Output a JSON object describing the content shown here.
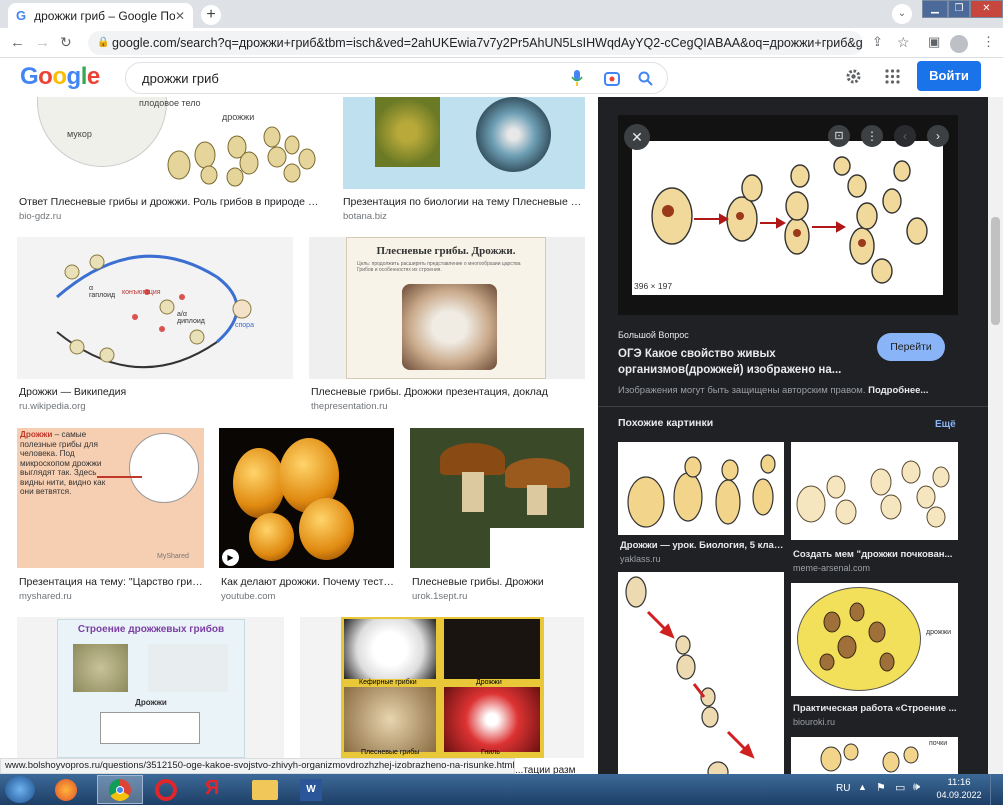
{
  "browser": {
    "tab_title": "дрожжи гриб – Google Поиск",
    "url": "google.com/search?q=дрожжи+гриб&tbm=isch&ved=2ahUKEwia7v7y2Pr5AhUN5LsIHWqdAyYQ2-cCegQIABAA&oq=дрожжи+гриб&gs_lcp=CgNpbW..."
  },
  "google": {
    "logo": "Google",
    "query": "дрожжи гриб",
    "signin_label": "Войти"
  },
  "results": [
    {
      "caption": "Ответ Плесневые грибы и дрожжи. Роль грибов в природе и жиз...",
      "site": "bio-gdz.ru"
    },
    {
      "caption": "Презентация по биологии на тему Плесневые гри...",
      "site": "botana.biz"
    },
    {
      "caption": "Дрожжи — Википедия",
      "site": "ru.wikipedia.org"
    },
    {
      "caption": "Плесневые грибы. Дрожжи презентация, доклад",
      "site": "thepresentation.ru"
    },
    {
      "caption": "Презентация на тему: \"Царство грибо...",
      "site": "myshared.ru"
    },
    {
      "caption": "Как делают дрожжи. Почему тесто ...",
      "site": "youtube.com"
    },
    {
      "caption": "Плесневые грибы. Дрожжи",
      "site": "urok.1sept.ru"
    }
  ],
  "thumb_text": {
    "r1a_1": "плодовое тело",
    "r1a_2": "мукор",
    "r1a_3": "дрожжи",
    "r2a_1": "α гаплоид",
    "r2a_2": "конъюгация",
    "r2a_3": "a/α диплоид",
    "r2a_4": "спора",
    "r2b_title": "Плесневые грибы. Дрожжи.",
    "r2b_sub": "Цель: продолжить расширять представление о многообразии царства Грибов и особенностях их строения.",
    "r3a_bold": "Дрожжи",
    "r3a_text": " – самые полезные грибы для человека. Под микроскопом дрожжи выглядят так. Здесь видны нити, видно как они ветвятся.",
    "r3a_brand": "MyShared",
    "r4a_title": "Строение дрожжевых грибов",
    "r4a_label": "Дрожжи",
    "r4b_1": "Кефирные грибки",
    "r4b_2": "Дрожжи",
    "r4b_3": "Плесневые грибы",
    "r4b_4": "Гниль",
    "r4b_cut": "...тации разм"
  },
  "panel": {
    "dims": "396 × 197",
    "source": "Большой Вопрос",
    "title": "ОГЭ Какое свойство живых организмов(дрожжей) изображено на...",
    "visit_label": "Перейти",
    "copyright": "Изображения могут быть защищены авторским правом.",
    "more_label": "Подробнее...",
    "similar_title": "Похожие картинки",
    "more_link": "Ещё",
    "similar": [
      {
        "caption": "Дрожжи — урок. Биология, 5 клас...",
        "site": "yaklass.ru"
      },
      {
        "caption": "Создать мем \"дрожжи почкован...",
        "site": "meme-arsenal.com"
      },
      {
        "caption": "Практическая работа «Строение ...",
        "site": "biouroki.ru"
      }
    ],
    "sim_label_drozhzhi": "дрожжи",
    "sim_label_pochki": "почки"
  },
  "status_url": "www.bolshoyvopros.ru/questions/3512150-oge-kakoe-svojstvo-zhivyh-organizmovdrozhzhej-izobrazheno-na-risunke.html",
  "taskbar": {
    "lang": "RU",
    "time": "11:16",
    "date": "04.09.2022"
  },
  "colors": {
    "signin": "#1a73e8",
    "panel_bg": "#202124",
    "visit_btn": "#8ab4f8",
    "link": "#8ab4f8"
  }
}
